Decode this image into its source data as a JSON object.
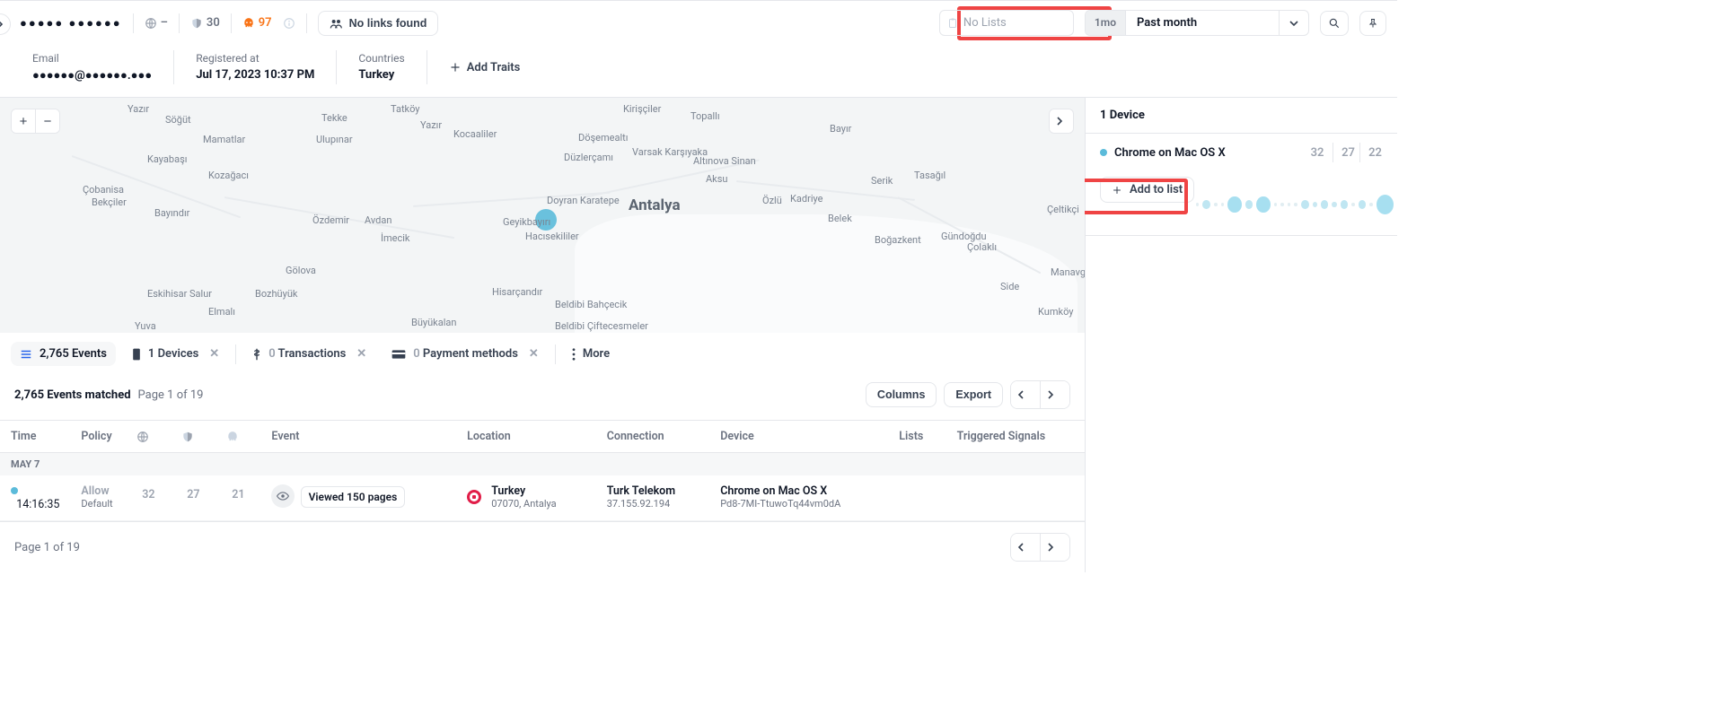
{
  "header": {
    "name_mask": "●●●●● ●●●●●●",
    "network_dash": "–",
    "shield_count": "30",
    "skull_count": "97",
    "no_links": "No links found",
    "no_lists": "No Lists",
    "period_chip": "1mo",
    "period_label": "Past month"
  },
  "meta": {
    "email_label": "Email",
    "email_value": "●●●●●●@●●●●●●.●●●",
    "registered_label": "Registered at",
    "registered_value": "Jul 17, 2023 10:37 PM",
    "countries_label": "Countries",
    "countries_value": "Turkey",
    "add_traits": "Add Traits"
  },
  "map": {
    "big_city": "Antalya",
    "labels": [
      {
        "t": "Yazır",
        "l": 142,
        "p": 6
      },
      {
        "t": "Söğüt",
        "l": 184,
        "p": 18
      },
      {
        "t": "Mamatlar",
        "l": 226,
        "p": 40
      },
      {
        "t": "Kayabaşı",
        "l": 164,
        "p": 62
      },
      {
        "t": "Kozağacı",
        "l": 232,
        "p": 80
      },
      {
        "t": "Çobanisa",
        "l": 92,
        "p": 96
      },
      {
        "t": "Bekçiler",
        "l": 102,
        "p": 110
      },
      {
        "t": "Bayındır",
        "l": 172,
        "p": 122
      },
      {
        "t": "Özdemir",
        "l": 348,
        "p": 130
      },
      {
        "t": "Avdan",
        "l": 406,
        "p": 130
      },
      {
        "t": "Gölova",
        "l": 318,
        "p": 186
      },
      {
        "t": "Bozhüyük",
        "l": 284,
        "p": 212
      },
      {
        "t": "Eskihisar Salur",
        "l": 164,
        "p": 212
      },
      {
        "t": "Elmalı",
        "l": 232,
        "p": 232
      },
      {
        "t": "Yuva",
        "l": 150,
        "p": 248
      },
      {
        "t": "Tekke",
        "l": 358,
        "p": 16
      },
      {
        "t": "Ulupınar",
        "l": 352,
        "p": 40
      },
      {
        "t": "Kocaaliler",
        "l": 505,
        "p": 34
      },
      {
        "t": "Tatköy",
        "l": 435,
        "p": 6
      },
      {
        "t": "Yazır",
        "l": 468,
        "p": 24
      },
      {
        "t": "İmecik",
        "l": 424,
        "p": 150
      },
      {
        "t": "Büyükalan",
        "l": 458,
        "p": 244
      },
      {
        "t": "Hisarçandır",
        "l": 548,
        "p": 210
      },
      {
        "t": "Hacısekililer",
        "l": 585,
        "p": 148
      },
      {
        "t": "Doyran Karatepe",
        "l": 609,
        "p": 108
      },
      {
        "t": "Geyikbayırı",
        "l": 560,
        "p": 132
      },
      {
        "t": "Beldibi Bahçecik",
        "l": 618,
        "p": 224
      },
      {
        "t": "Beldibi Çiftecesmeler",
        "l": 618,
        "p": 248
      },
      {
        "t": "Kirişçiler",
        "l": 694,
        "p": 6
      },
      {
        "t": "Döşemealtı",
        "l": 644,
        "p": 38
      },
      {
        "t": "Düzlerçamı",
        "l": 628,
        "p": 60
      },
      {
        "t": "Varsak Karşıyaka",
        "l": 704,
        "p": 54
      },
      {
        "t": "Altınova Sinan",
        "l": 772,
        "p": 64
      },
      {
        "t": "Topallı",
        "l": 769,
        "p": 14
      },
      {
        "t": "Aksu",
        "l": 786,
        "p": 84
      },
      {
        "t": "Özlü",
        "l": 849,
        "p": 108
      },
      {
        "t": "Kadriye",
        "l": 880,
        "p": 106
      },
      {
        "t": "Belek",
        "l": 922,
        "p": 128
      },
      {
        "t": "Serik",
        "l": 970,
        "p": 86
      },
      {
        "t": "Boğazkent",
        "l": 974,
        "p": 152
      },
      {
        "t": "Tasağıl",
        "l": 1018,
        "p": 80
      },
      {
        "t": "Gündoğdu",
        "l": 1048,
        "p": 148
      },
      {
        "t": "Çolaklı",
        "l": 1077,
        "p": 160
      },
      {
        "t": "Side",
        "l": 1114,
        "p": 204
      },
      {
        "t": "Çeltikçi",
        "l": 1166,
        "p": 118
      },
      {
        "t": "Manavgat",
        "l": 1170,
        "p": 188
      },
      {
        "t": "Bayır",
        "l": 924,
        "p": 28
      },
      {
        "t": "Kumköy",
        "l": 1156,
        "p": 232
      }
    ]
  },
  "tabs": {
    "events": "2,765 Events",
    "devices": "1 Devices",
    "transactions_zero": "0",
    "transactions": " Transactions",
    "payment_zero": "0",
    "payment": " Payment methods",
    "more": "More"
  },
  "events": {
    "matched": "2,765 Events matched",
    "page": "Page 1 of 19",
    "columns_btn": "Columns",
    "export_btn": "Export",
    "columns": {
      "time": "Time",
      "policy": "Policy",
      "event": "Event",
      "location": "Location",
      "connection": "Connection",
      "device": "Device",
      "lists": "Lists",
      "signals": "Triggered Signals"
    },
    "group_date": "MAY 7",
    "rows": [
      {
        "time": "14:16:35",
        "policy_allow": "Allow",
        "policy_default": "Default",
        "n1": "32",
        "n2": "27",
        "n3": "21",
        "event_badge": "Viewed 150 pages",
        "location_1": "Turkey",
        "location_2": "07070, Antalya",
        "conn_1": "Turk Telekom",
        "conn_2": "37.155.92.194",
        "device_1": "Chrome on Mac OS X",
        "device_2": "Pd8-7MI-TtuwoTq44vm0dA"
      }
    ],
    "footer_page": "Page 1 of 19"
  },
  "right": {
    "devices_title": "1 Device",
    "device_name": "Chrome on Mac OS X",
    "n1": "32",
    "n2": "27",
    "n3": "22",
    "add_to_list": "Add to list"
  }
}
